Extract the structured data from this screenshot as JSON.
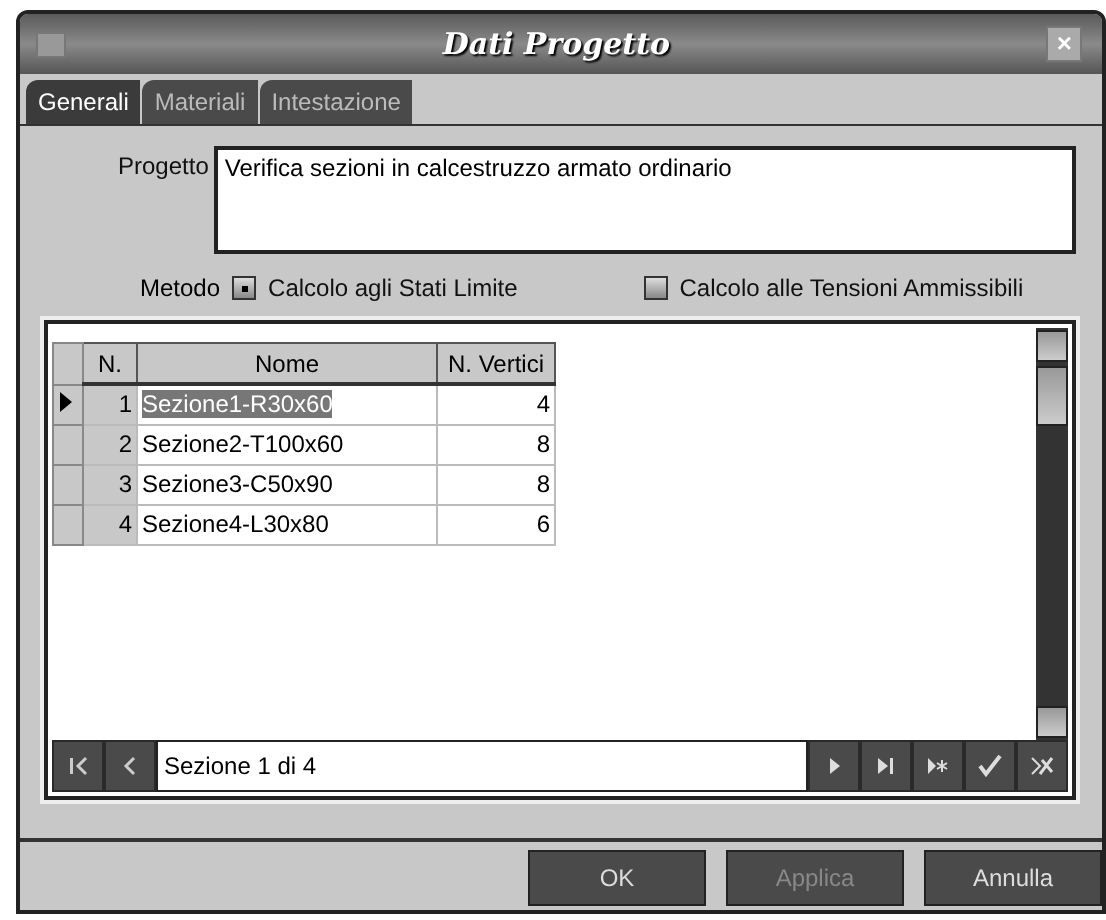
{
  "window": {
    "title": "Dati Progetto",
    "close": "×"
  },
  "tabs": [
    {
      "label": "Generali",
      "selected": true
    },
    {
      "label": "Materiali",
      "selected": false
    },
    {
      "label": "Intestazione",
      "selected": false
    }
  ],
  "project": {
    "label": "Progetto",
    "value": "Verifica sezioni in calcestruzzo armato ordinario"
  },
  "method": {
    "label": "Metodo",
    "options": [
      {
        "label": "Calcolo agli Stati Limite",
        "selected": true
      },
      {
        "label": "Calcolo alle Tensioni Ammissibili",
        "selected": false
      }
    ]
  },
  "table": {
    "columns": [
      "N.",
      "Nome",
      "N. Vertici"
    ],
    "rows": [
      {
        "n": "1",
        "name": "Sezione1-R30x60",
        "vertices": "4",
        "selected": true
      },
      {
        "n": "2",
        "name": "Sezione2-T100x60",
        "vertices": "8",
        "selected": false
      },
      {
        "n": "3",
        "name": "Sezione3-C50x90",
        "vertices": "8",
        "selected": false
      },
      {
        "n": "4",
        "name": "Sezione4-L30x80",
        "vertices": "6",
        "selected": false
      }
    ]
  },
  "navigator": {
    "status": "Sezione 1 di 4"
  },
  "buttons": [
    {
      "label": "OK",
      "disabled": false
    },
    {
      "label": "Applica",
      "disabled": true
    },
    {
      "label": "Annulla",
      "disabled": false
    }
  ]
}
